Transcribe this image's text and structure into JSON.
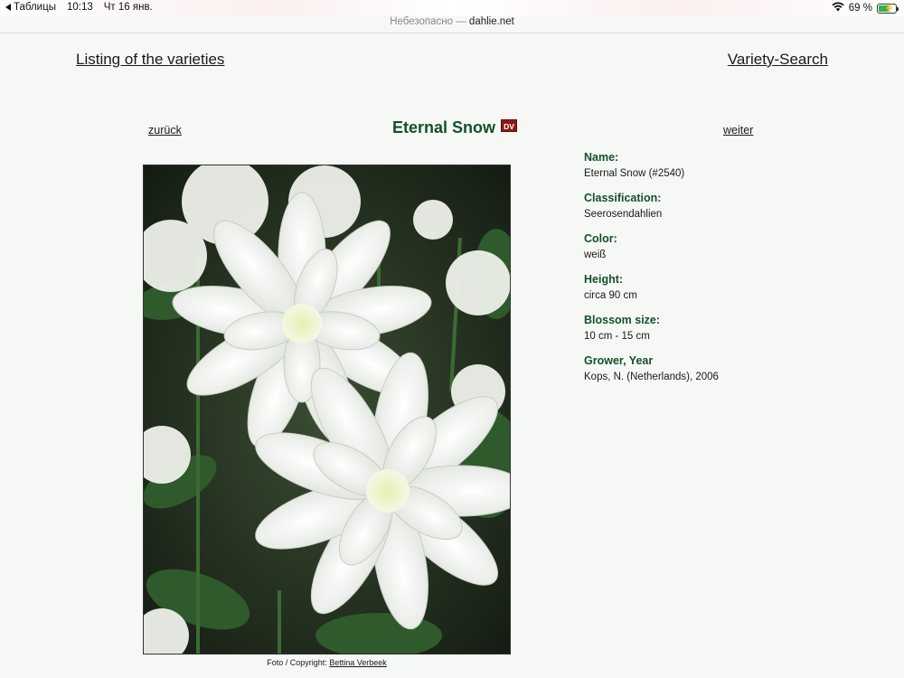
{
  "status_bar": {
    "back_app": "Таблицы",
    "time": "10:13",
    "date": "Чт 16 янв.",
    "battery": "69 %",
    "battery_level": 0.69
  },
  "url_bar": {
    "security": "Небезопасно",
    "separator": " — ",
    "domain": "dahlie.net"
  },
  "header": {
    "listing_link": "Listing of the varieties",
    "search_link": "Variety-Search"
  },
  "nav": {
    "prev": "zurück",
    "next": "weiter"
  },
  "variety": {
    "title": "Eternal Snow",
    "badge": "DV"
  },
  "credit": {
    "prefix": "Foto / Copyright: ",
    "author": "Bettina Verbeek"
  },
  "details": {
    "name_label": "Name:",
    "name_value": "Eternal Snow (#2540)",
    "classification_label": "Classification:",
    "classification_value": "Seerosendahlien",
    "color_label": "Color:",
    "color_value": "weiß",
    "height_label": "Height:",
    "height_value": "circa 90 cm",
    "blossom_label": "Blossom size:",
    "blossom_value": "10 cm - 15 cm",
    "grower_label": "Grower, Year",
    "grower_value": "Kops, N. (Netherlands), 2006"
  },
  "colors": {
    "label_green": "#14502a",
    "badge_red": "#8b1a1a",
    "battery_green": "#2fb24a"
  }
}
